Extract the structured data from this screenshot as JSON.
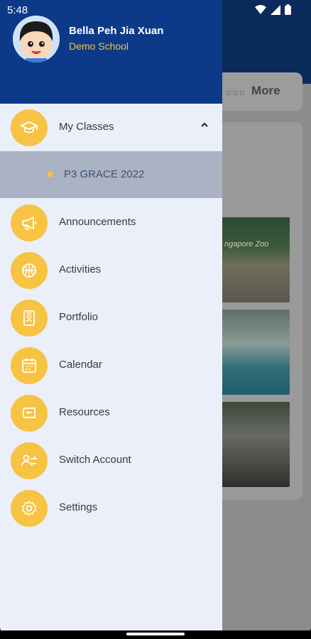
{
  "status_bar": {
    "time": "5:48"
  },
  "background": {
    "more_label": "More",
    "photo_text": "ngapore Zoo"
  },
  "drawer": {
    "user": {
      "name": "Bella Peh Jia Xuan",
      "school": "Demo School"
    },
    "menu": [
      {
        "label": "My Classes",
        "icon": "graduation-cap-icon",
        "expanded": true
      },
      {
        "label": "Announcements",
        "icon": "megaphone-icon"
      },
      {
        "label": "Activities",
        "icon": "basketball-icon"
      },
      {
        "label": "Portfolio",
        "icon": "portfolio-icon"
      },
      {
        "label": "Calendar",
        "icon": "calendar-icon"
      },
      {
        "label": "Resources",
        "icon": "resources-icon"
      },
      {
        "label": "Switch Account",
        "icon": "switch-account-icon"
      },
      {
        "label": "Settings",
        "icon": "settings-icon"
      }
    ],
    "classes": [
      {
        "label": "P3 GRACE 2022"
      }
    ]
  },
  "colors": {
    "accent": "#f6c343",
    "header": "#0c3a88",
    "drawer_bg": "#ebeff9"
  }
}
